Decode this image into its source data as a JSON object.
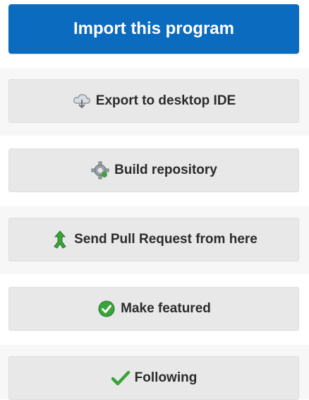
{
  "actions": {
    "import_label": "Import this program",
    "export_label": "Export to desktop IDE",
    "build_label": "Build repository",
    "pull_request_label": "Send Pull Request from here",
    "featured_label": "Make featured",
    "following_label": "Following"
  },
  "icons": {
    "export": "cloud-download-icon",
    "build": "gear-icon",
    "pull_request": "branch-merge-icon",
    "featured": "check-circle-icon",
    "following": "checkmark-icon"
  },
  "colors": {
    "primary": "#0b6bbf",
    "button_bg": "#e8e8e8",
    "success_green": "#3aa33a"
  }
}
